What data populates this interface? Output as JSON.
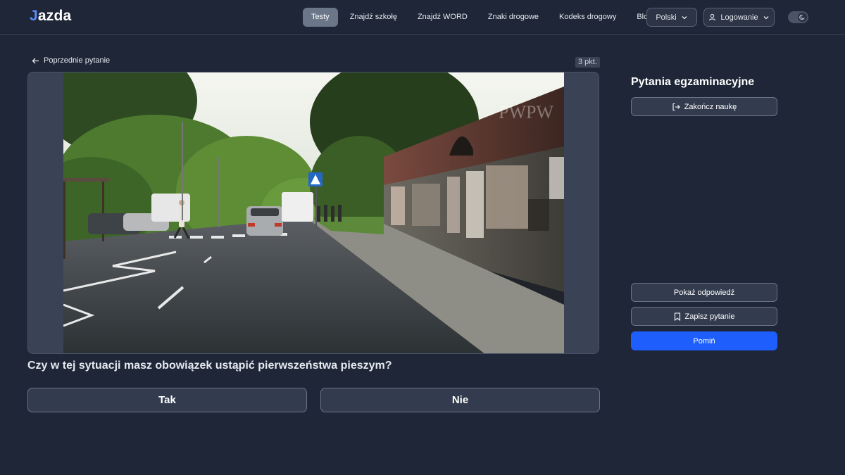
{
  "brand": {
    "name": "azda",
    "mark": "J"
  },
  "nav": {
    "items": [
      {
        "label": "Testy",
        "active": true
      },
      {
        "label": "Znajdź szkołę"
      },
      {
        "label": "Znajdź WORD"
      },
      {
        "label": "Znaki drogowe"
      },
      {
        "label": "Kodeks drogowy"
      },
      {
        "label": "Blog"
      }
    ],
    "language": "Polski",
    "login": "Logowanie",
    "theme_toggle_icon": "moon-icon"
  },
  "question": {
    "back_label": "Poprzednie pytanie",
    "points": "3 pkt.",
    "text": "Czy w tej sytuacji masz obowiązek ustąpić pierwszeństwa pieszym?",
    "answers": {
      "yes": "Tak",
      "no": "Nie"
    },
    "watermark": "PWPW"
  },
  "sidebar": {
    "title": "Pytania egzaminacyjne",
    "finish": "Zakończ naukę",
    "show_answer": "Pokaż odpowiedź",
    "save_question": "Zapisz pytanie",
    "skip": "Pomiń"
  },
  "colors": {
    "background": "#1e2637",
    "accent": "#1d5efc",
    "active_nav": "#6b7689"
  }
}
